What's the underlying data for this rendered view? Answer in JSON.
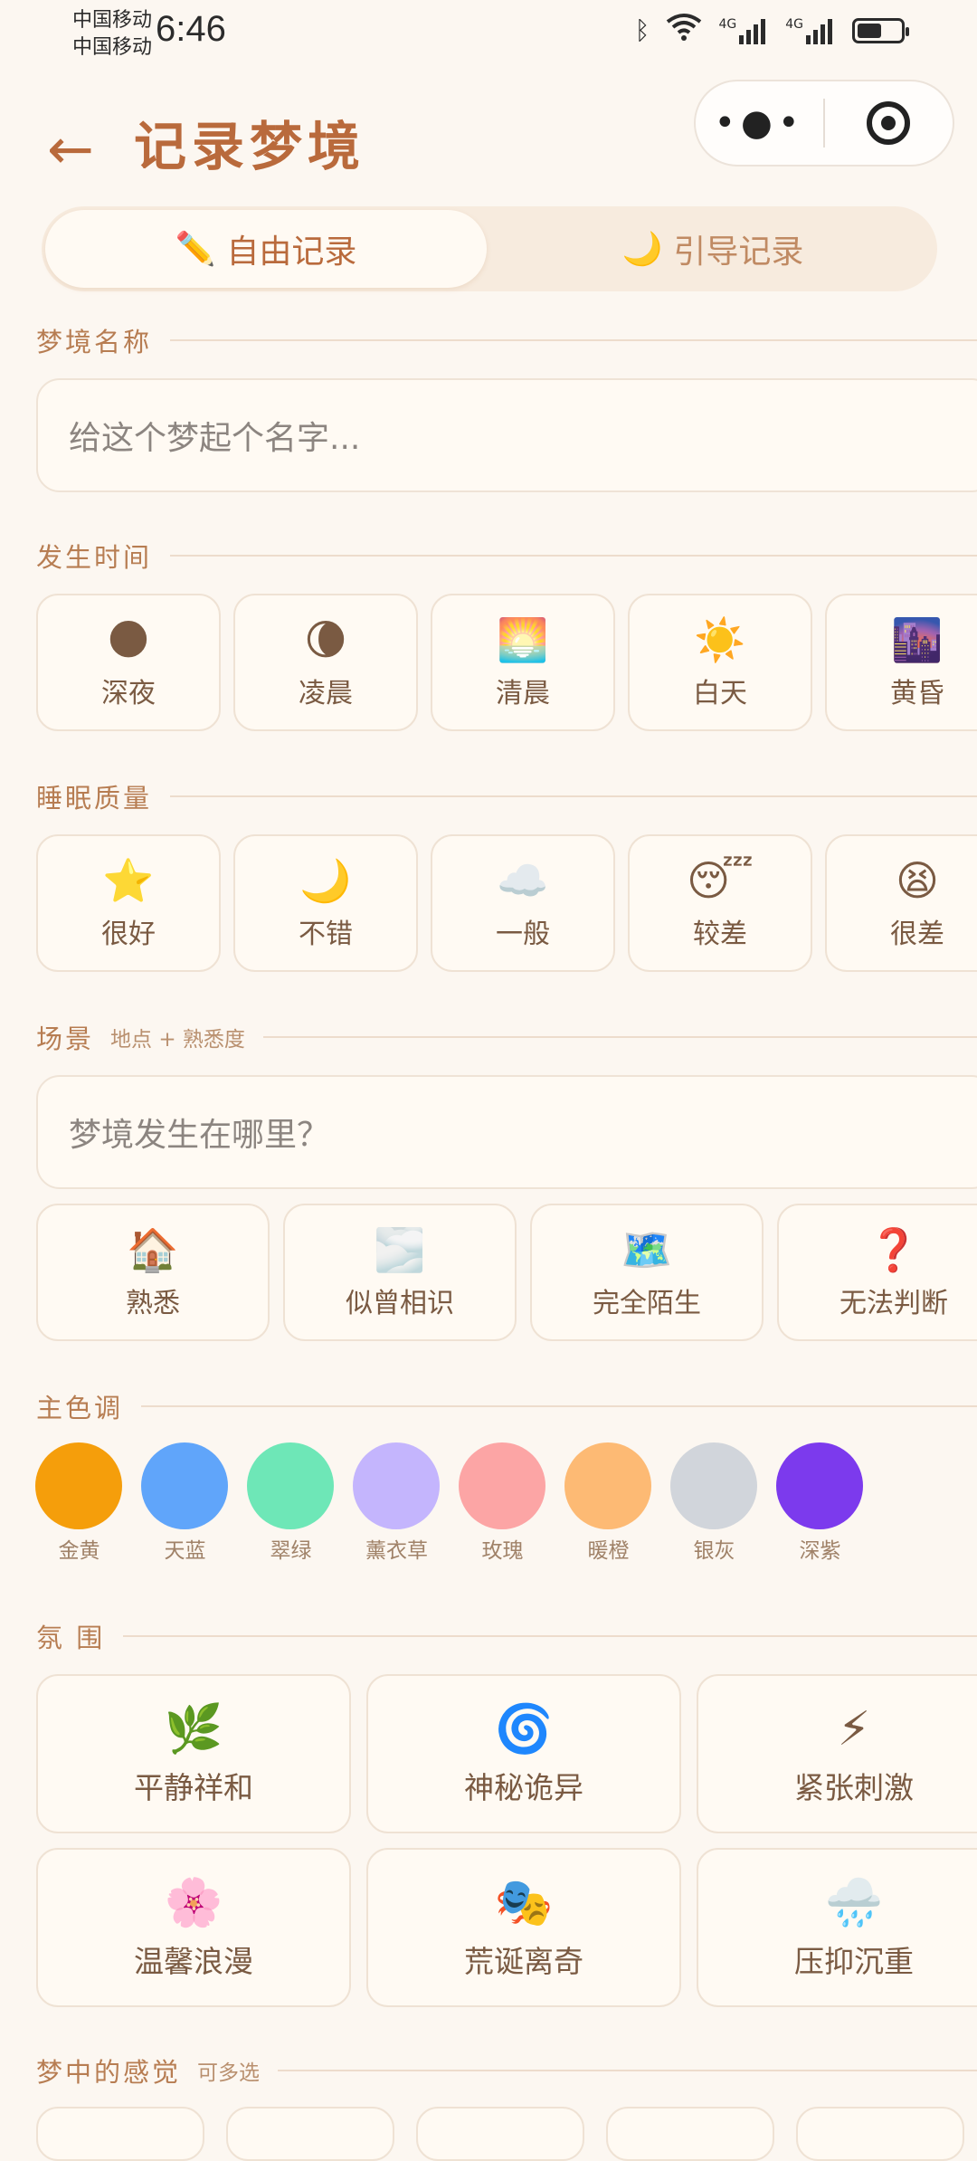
{
  "status_bar": {
    "carrier_1": "中国移动",
    "carrier_2": "中国移动",
    "time": "6:46",
    "network_1": "4G",
    "network_2": "4G"
  },
  "header": {
    "back_glyph": "←",
    "title": "记录梦境"
  },
  "tabs": [
    {
      "icon": "✏️",
      "label": "自由记录",
      "active": true
    },
    {
      "icon": "🌙",
      "label": "引导记录",
      "active": false
    }
  ],
  "dream_name": {
    "label": "梦境名称",
    "placeholder": "给这个梦起个名字..."
  },
  "time_section": {
    "label": "发生时间",
    "options": [
      {
        "icon": "🌑",
        "label": "深夜"
      },
      {
        "icon": "🌘",
        "label": "凌晨"
      },
      {
        "icon": "🌅",
        "label": "清晨"
      },
      {
        "icon": "☀️",
        "label": "白天"
      },
      {
        "icon": "🌆",
        "label": "黄昏"
      }
    ]
  },
  "sleep_section": {
    "label": "睡眠质量",
    "options": [
      {
        "icon": "⭐",
        "label": "很好"
      },
      {
        "icon": "🌙",
        "label": "不错"
      },
      {
        "icon": "☁️",
        "label": "一般"
      },
      {
        "icon": "😴",
        "label": "较差"
      },
      {
        "icon": "😫",
        "label": "很差"
      }
    ]
  },
  "scene_section": {
    "label": "场景",
    "hint": "地点 + 熟悉度",
    "placeholder": "梦境发生在哪里？",
    "options": [
      {
        "icon": "🏠",
        "label": "熟悉"
      },
      {
        "icon": "🌫️",
        "label": "似曾相识"
      },
      {
        "icon": "🗺️",
        "label": "完全陌生"
      },
      {
        "icon": "❓",
        "label": "无法判断"
      }
    ]
  },
  "color_section": {
    "label": "主色调",
    "colors": [
      {
        "label": "金黄",
        "hex": "#f59e0b"
      },
      {
        "label": "天蓝",
        "hex": "#60a5fa"
      },
      {
        "label": "翠绿",
        "hex": "#6ee7b7"
      },
      {
        "label": "薰衣草",
        "hex": "#c4b5fd"
      },
      {
        "label": "玫瑰",
        "hex": "#fca5a5"
      },
      {
        "label": "暖橙",
        "hex": "#fdba74"
      },
      {
        "label": "银灰",
        "hex": "#d1d5db"
      },
      {
        "label": "深紫",
        "hex": "#7c3aed"
      }
    ]
  },
  "mood_section": {
    "label": "氛 围",
    "options": [
      {
        "icon": "🌿",
        "label": "平静祥和"
      },
      {
        "icon": "🌀",
        "label": "神秘诡异"
      },
      {
        "icon": "⚡",
        "label": "紧张刺激"
      },
      {
        "icon": "🌸",
        "label": "温馨浪漫"
      },
      {
        "icon": "🎭",
        "label": "荒诞离奇"
      },
      {
        "icon": "🌧️",
        "label": "压抑沉重"
      }
    ]
  },
  "feeling_section": {
    "label": "梦中的感觉",
    "hint": "可多选"
  }
}
